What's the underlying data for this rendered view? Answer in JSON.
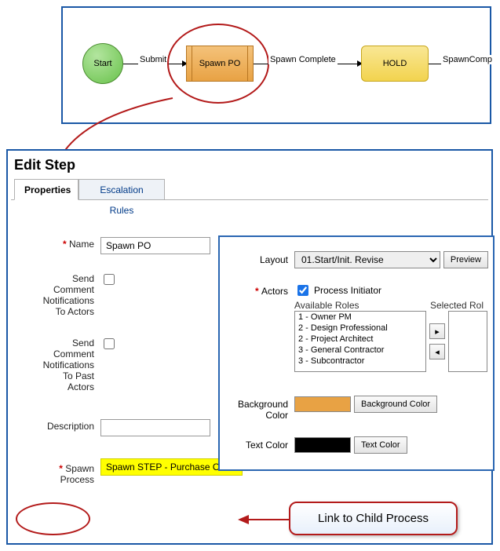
{
  "diagram": {
    "start_label": "Start",
    "spawn_label": "Spawn PO",
    "hold_label": "HOLD",
    "flow1_label": "Submit",
    "flow2_label": "Spawn Complete",
    "flow3_label": "SpawnComp"
  },
  "panel_title": "Edit Step",
  "tabs": {
    "properties": "Properties",
    "escalation": "Escalation Rules"
  },
  "form": {
    "name_label": "Name",
    "name_value": "Spawn PO",
    "send_comment_label": "Send\nComment\nNotifications\nTo Actors",
    "send_comment_past_label": "Send\nComment\nNotifications\nTo Past\nActors",
    "description_label": "Description",
    "description_value": "",
    "spawn_label": "Spawn\nProcess",
    "spawn_value": "Spawn STEP - Purchase Order"
  },
  "overlay": {
    "layout_label": "Layout",
    "layout_value": "01.Start/Init. Revise",
    "preview_btn": "Preview",
    "actors_label": "Actors",
    "process_initiator_label": "Process Initiator",
    "process_initiator_checked": true,
    "available_roles_header": "Available Roles",
    "selected_roles_header": "Selected Rol",
    "available_roles": [
      "1 - Owner PM",
      "2 - Design Professional",
      "2 - Project Architect",
      "3 - General Contractor",
      "3 - Subcontractor"
    ],
    "bgcolor_label": "Background\nColor",
    "bgcolor_btn": "Background Color",
    "bgcolor_value": "#e8a244",
    "textcolor_label": "Text Color",
    "textcolor_btn": "Text Color",
    "textcolor_value": "#000000"
  },
  "callout_text": "Link to Child Process"
}
